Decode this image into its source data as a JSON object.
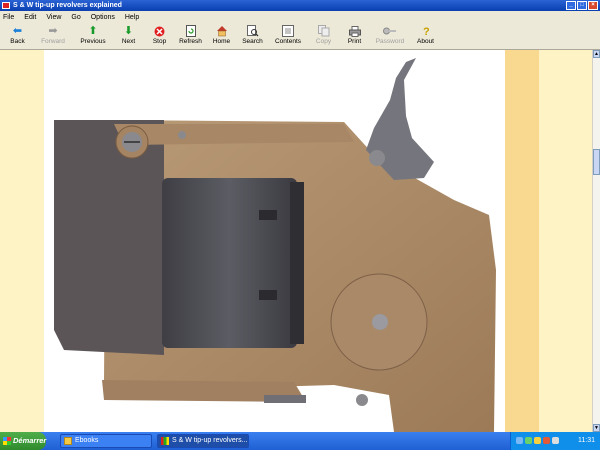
{
  "window": {
    "title": "S & W tip-up revolvers explained"
  },
  "menu": [
    "File",
    "Edit",
    "View",
    "Go",
    "Options",
    "Help"
  ],
  "toolbar": [
    {
      "label": "Back",
      "icon": "back-arrow-icon",
      "enabled": true
    },
    {
      "label": "Forward",
      "icon": "forward-arrow-icon",
      "enabled": false
    },
    {
      "label": "Previous",
      "icon": "up-arrow-icon",
      "enabled": true
    },
    {
      "label": "Next",
      "icon": "down-arrow-icon",
      "enabled": true
    },
    {
      "label": "Stop",
      "icon": "stop-icon",
      "enabled": true
    },
    {
      "label": "Refresh",
      "icon": "refresh-icon",
      "enabled": true
    },
    {
      "label": "Home",
      "icon": "home-icon",
      "enabled": true
    },
    {
      "label": "Search",
      "icon": "search-icon",
      "enabled": true
    },
    {
      "label": "Contents",
      "icon": "contents-icon",
      "enabled": true
    },
    {
      "label": "Copy",
      "icon": "copy-icon",
      "enabled": false
    },
    {
      "label": "Print",
      "icon": "print-icon",
      "enabled": true
    },
    {
      "label": "Password",
      "icon": "key-icon",
      "enabled": false
    },
    {
      "label": "About",
      "icon": "about-icon",
      "enabled": true
    }
  ],
  "content": {
    "image": "revolver-frame-photo"
  },
  "taskbar": {
    "start_label": "Démarrer",
    "tasks": [
      {
        "label": "Ebooks",
        "icon": "folder-icon"
      },
      {
        "label": "S & W tip-up revolvers...",
        "icon": "app-icon"
      }
    ],
    "clock": "11:31"
  },
  "colors": {
    "accent": "#0a3fb0",
    "page_bg": "#fdf3c4",
    "side_band": "#f8d98f"
  }
}
